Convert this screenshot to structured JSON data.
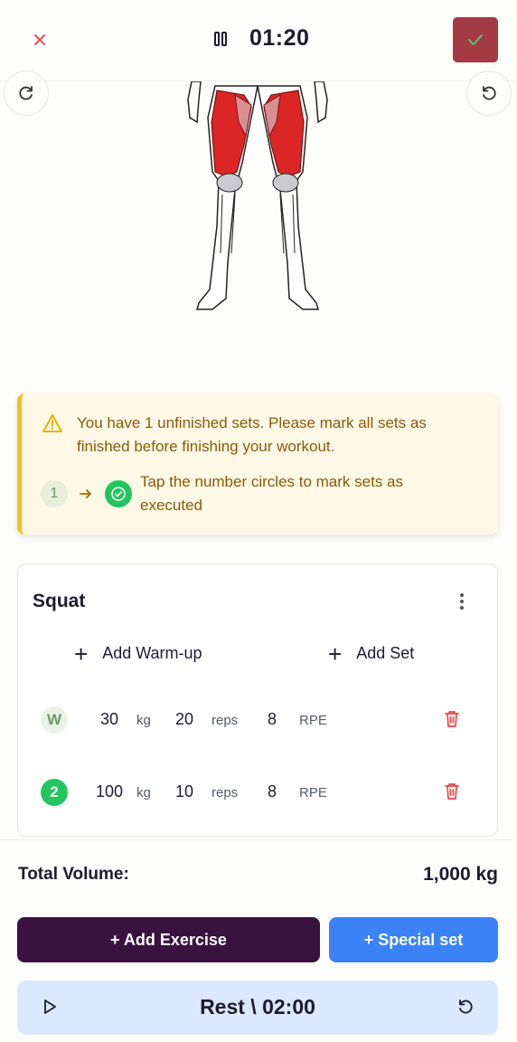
{
  "header": {
    "timer": "01:20",
    "accent_color": "#a33a44"
  },
  "warning": {
    "message": "You have 1 unfinished sets. Please mark all sets as finished before finishing your workout.",
    "step_number": "1",
    "tip": "Tap the number circles to mark sets as executed"
  },
  "exercise": {
    "name": "Squat",
    "add_warmup_label": "Add Warm-up",
    "add_set_label": "Add Set",
    "sets": [
      {
        "badge": "W",
        "weight": "30",
        "weight_unit": "kg",
        "reps": "20",
        "reps_unit": "reps",
        "rpe": "8",
        "rpe_unit": "RPE",
        "done": false
      },
      {
        "badge": "2",
        "weight": "100",
        "weight_unit": "kg",
        "reps": "10",
        "reps_unit": "reps",
        "rpe": "8",
        "rpe_unit": "RPE",
        "done": true
      }
    ]
  },
  "footer": {
    "total_volume_label": "Total Volume:",
    "total_volume_value": "1,000 kg",
    "add_exercise_label": "+ Add Exercise",
    "special_set_label": "+ Special set",
    "rest_label": "Rest \\ 02:00"
  },
  "icons": {
    "close": "close-icon",
    "pause": "pause-icon",
    "finish": "check-icon",
    "rotate": "rotate-icon",
    "undo": "undo-icon",
    "warning": "warning-icon",
    "play": "play-icon",
    "trash": "trash-icon",
    "reset": "reset-icon"
  },
  "colors": {
    "primary_dark": "#3a1240",
    "primary_blue": "#3b82f6",
    "success": "#22c55e",
    "danger": "#ef4444",
    "warning_bg": "#fef8e6",
    "warning_border": "#f2c21b"
  }
}
